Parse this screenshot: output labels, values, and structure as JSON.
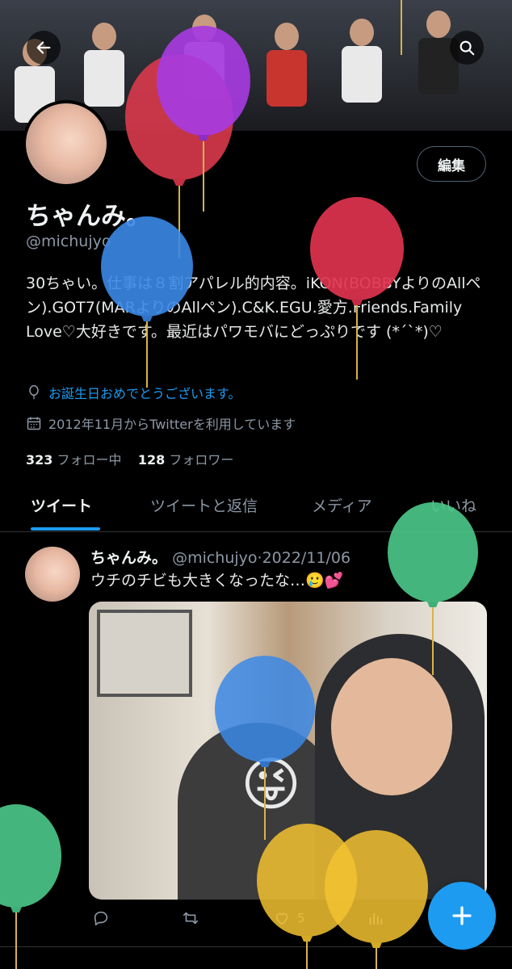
{
  "colors": {
    "accent": "#1d9bf0",
    "background": "#000000",
    "muted": "#8b98a5"
  },
  "header": {
    "back_icon": "arrow-left-icon",
    "search_icon": "search-icon",
    "edit_label": "編集"
  },
  "profile": {
    "name": "ちゃんみ。",
    "handle": "@michujyo",
    "bio": "30ちゃい。仕事は８割アパレル的内容。iKON(BOBBYよりのAllペン).GOT7(MARよりのAllペン).C&K.EGU.愛方.Friends.Family Love♡大好きです。最近はパワモバにどっぷりです (*´`*)♡",
    "birthday_text": "お誕生日おめでとうございます。",
    "joined_text": "2012年11月からTwitterを利用しています",
    "following_count": "323",
    "following_label": "フォロー中",
    "followers_count": "128",
    "followers_label": "フォロワー"
  },
  "tabs": [
    {
      "label": "ツイート",
      "active": true
    },
    {
      "label": "ツイートと返信",
      "active": false
    },
    {
      "label": "メディア",
      "active": false
    },
    {
      "label": "いいね",
      "active": false
    }
  ],
  "tweet": {
    "name": "ちゃんみ。",
    "handle": "@michujyo",
    "separator": "·",
    "date": "2022/11/06",
    "text": "ウチのチビも大きくなったな…🥲💕",
    "like_count": "5",
    "emoji_sticker": "😜"
  },
  "fab": {
    "icon": "plus-icon"
  }
}
